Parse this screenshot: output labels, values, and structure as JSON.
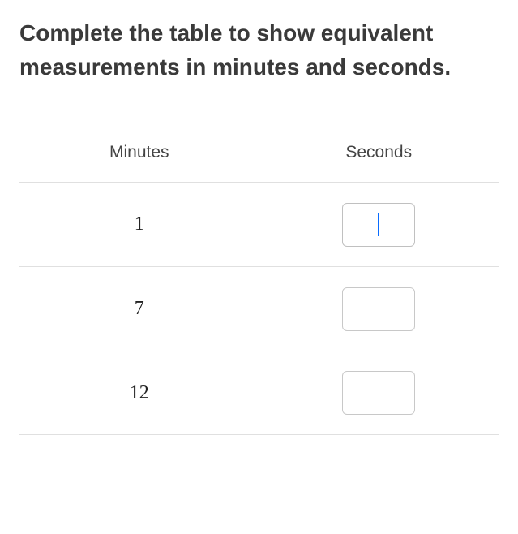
{
  "prompt": "Complete the table to show equivalent measurements in minutes and seconds.",
  "table": {
    "headers": {
      "minutes": "Minutes",
      "seconds": "Seconds"
    },
    "rows": [
      {
        "minutes": "1",
        "seconds": "",
        "focused": true
      },
      {
        "minutes": "7",
        "seconds": "",
        "focused": false
      },
      {
        "minutes": "12",
        "seconds": "",
        "focused": false
      }
    ]
  }
}
